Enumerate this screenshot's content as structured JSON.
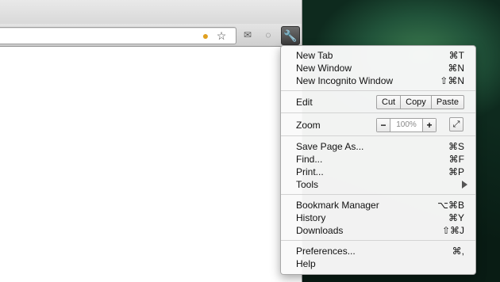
{
  "menu": {
    "new_tab": {
      "label": "New Tab",
      "shortcut": "⌘T"
    },
    "new_window": {
      "label": "New Window",
      "shortcut": "⌘N"
    },
    "new_incognito": {
      "label": "New Incognito Window",
      "shortcut": "⇧⌘N"
    },
    "edit": {
      "label": "Edit",
      "cut": "Cut",
      "copy": "Copy",
      "paste": "Paste"
    },
    "zoom": {
      "label": "Zoom",
      "minus": "−",
      "value": "100%",
      "plus": "+"
    },
    "save_page": {
      "label": "Save Page As...",
      "shortcut": "⌘S"
    },
    "find": {
      "label": "Find...",
      "shortcut": "⌘F"
    },
    "print": {
      "label": "Print...",
      "shortcut": "⌘P"
    },
    "tools": {
      "label": "Tools"
    },
    "bookmark_manager": {
      "label": "Bookmark Manager",
      "shortcut": "⌥⌘B"
    },
    "history": {
      "label": "History",
      "shortcut": "⌘Y"
    },
    "downloads": {
      "label": "Downloads",
      "shortcut": "⇧⌘J"
    },
    "preferences": {
      "label": "Preferences...",
      "shortcut": "⌘,"
    },
    "help": {
      "label": "Help"
    }
  },
  "icons": {
    "page_action": "cookie-icon",
    "bookmark_star": "star-icon",
    "extension_1": "mail-icon",
    "extension_2": "chat-icon",
    "wrench": "wrench-icon"
  }
}
